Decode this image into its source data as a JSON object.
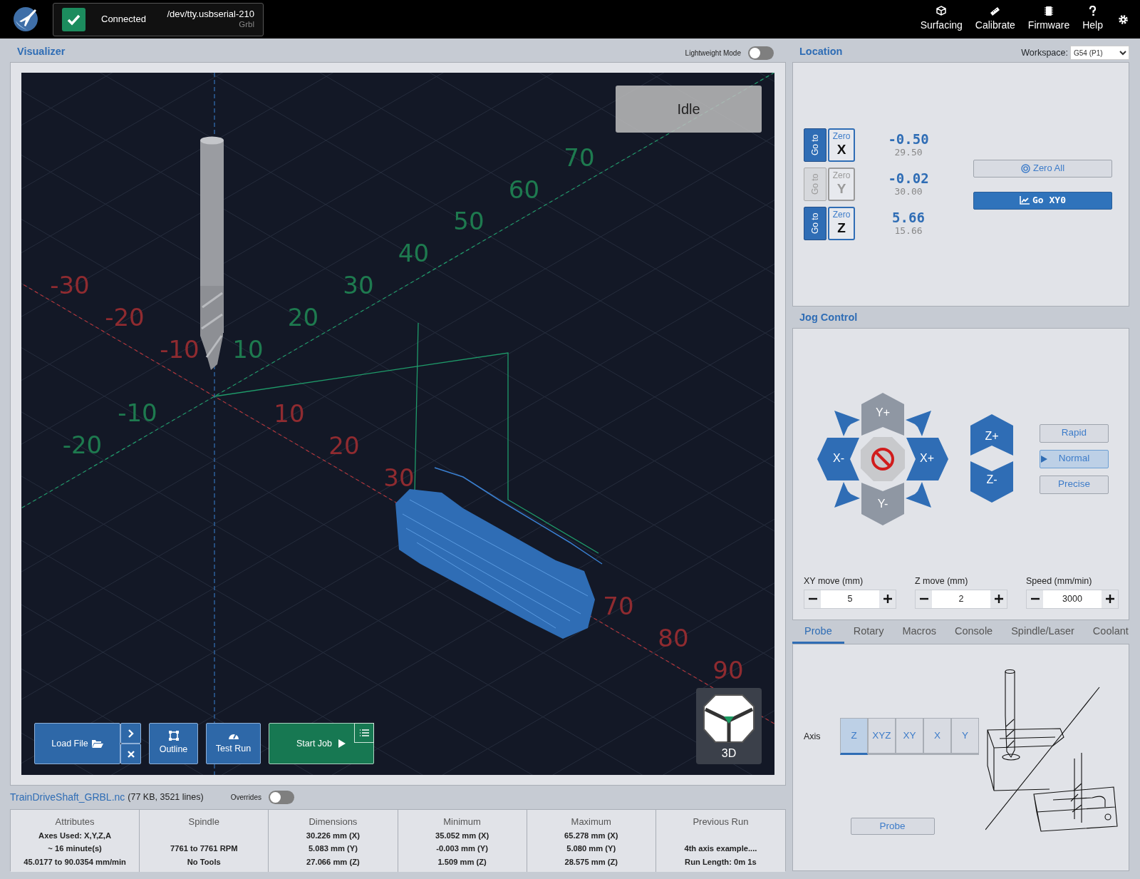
{
  "header": {
    "connection": {
      "status": "Connected",
      "port": "/dev/tty.usbserial-210",
      "firmware": "Grbl"
    },
    "nav": [
      {
        "label": "Surfacing"
      },
      {
        "label": "Calibrate"
      },
      {
        "label": "Firmware"
      },
      {
        "label": "Help"
      }
    ]
  },
  "visualizer": {
    "title": "Visualizer",
    "lightweight_mode": {
      "label": "Lightweight Mode",
      "on": false
    },
    "machine_state": "Idle",
    "x_axis_labels": [
      "-30",
      "-20",
      "-10",
      "10",
      "20",
      "30",
      "70",
      "80",
      "90"
    ],
    "y_axis_labels": [
      "-20",
      "-10",
      "10",
      "20",
      "30",
      "40",
      "50",
      "60",
      "70"
    ],
    "view_cube": "3D",
    "load_file": "Load File",
    "outline": "Outline",
    "test_run": "Test Run",
    "start_job": "Start Job"
  },
  "file": {
    "name": "TrainDriveShaft_GRBL.nc",
    "info": "(77 KB, 3521 lines)",
    "overrides": {
      "label": "Overrides",
      "on": false
    }
  },
  "stats": [
    {
      "title": "Attributes",
      "lines": [
        "Axes Used: X,Y,Z,A",
        "~ 16 minute(s)",
        "45.0177 to 90.0354 mm/min"
      ]
    },
    {
      "title": "Spindle",
      "lines": [
        "7761 to 7761 RPM",
        "No Tools"
      ]
    },
    {
      "title": "Dimensions",
      "lines": [
        "30.226 mm (X)",
        "5.083 mm (Y)",
        "27.066 mm (Z)"
      ]
    },
    {
      "title": "Minimum",
      "lines": [
        "35.052 mm (X)",
        "-0.003 mm (Y)",
        "1.509 mm (Z)"
      ]
    },
    {
      "title": "Maximum",
      "lines": [
        "65.278 mm (X)",
        "5.080 mm (Y)",
        "28.575 mm (Z)"
      ]
    },
    {
      "title": "Previous Run",
      "lines": [
        "4th axis example....",
        "Run Length: 0m 1s"
      ]
    }
  ],
  "location": {
    "title": "Location",
    "workspace_label": "Workspace:",
    "workspace": "G54 (P1)",
    "axes": [
      {
        "goto": "Go to",
        "zero": "Zero",
        "axis": "X",
        "disabled": false,
        "value": "-0.50",
        "machine": "29.50"
      },
      {
        "goto": "Go to",
        "zero": "Zero",
        "axis": "Y",
        "disabled": true,
        "value": "-0.02",
        "machine": "30.00"
      },
      {
        "goto": "Go to",
        "zero": "Zero",
        "axis": "Z",
        "disabled": false,
        "value": "5.66",
        "machine": "15.66"
      }
    ],
    "zero_all": "Zero All",
    "go_xy0": "Go XY0"
  },
  "jog": {
    "title": "Jog Control",
    "keys": [
      {
        "kind": "y_plus",
        "label": "Y+",
        "disabled": true
      },
      {
        "kind": "x_minus",
        "label": "X-",
        "disabled": false
      },
      {
        "kind": "x_plus",
        "label": "X+",
        "disabled": false
      },
      {
        "kind": "y_minus",
        "label": "Y-",
        "disabled": true
      },
      {
        "kind": "z_plus",
        "label": "Z+",
        "disabled": false
      },
      {
        "kind": "z_minus",
        "label": "Z-",
        "disabled": false
      }
    ],
    "speeds": [
      {
        "label": "Rapid",
        "selected": false
      },
      {
        "label": "Normal",
        "selected": true
      },
      {
        "label": "Precise",
        "selected": false
      }
    ],
    "steppers": [
      {
        "label": "XY move (mm)",
        "value": "5"
      },
      {
        "label": "Z move (mm)",
        "value": "2"
      },
      {
        "label": "Speed (mm/min)",
        "value": "3000"
      }
    ]
  },
  "tabs": [
    {
      "label": "Probe",
      "selected": true
    },
    {
      "label": "Rotary",
      "selected": false
    },
    {
      "label": "Macros",
      "selected": false
    },
    {
      "label": "Console",
      "selected": false
    },
    {
      "label": "Spindle/Laser",
      "selected": false
    },
    {
      "label": "Coolant",
      "selected": false
    }
  ],
  "probe": {
    "axis_label": "Axis",
    "axes": [
      {
        "label": "Z",
        "selected": true
      },
      {
        "label": "XYZ",
        "selected": false
      },
      {
        "label": "XY",
        "selected": false
      },
      {
        "label": "X",
        "selected": false
      },
      {
        "label": "Y",
        "selected": false
      }
    ],
    "button": "Probe"
  }
}
